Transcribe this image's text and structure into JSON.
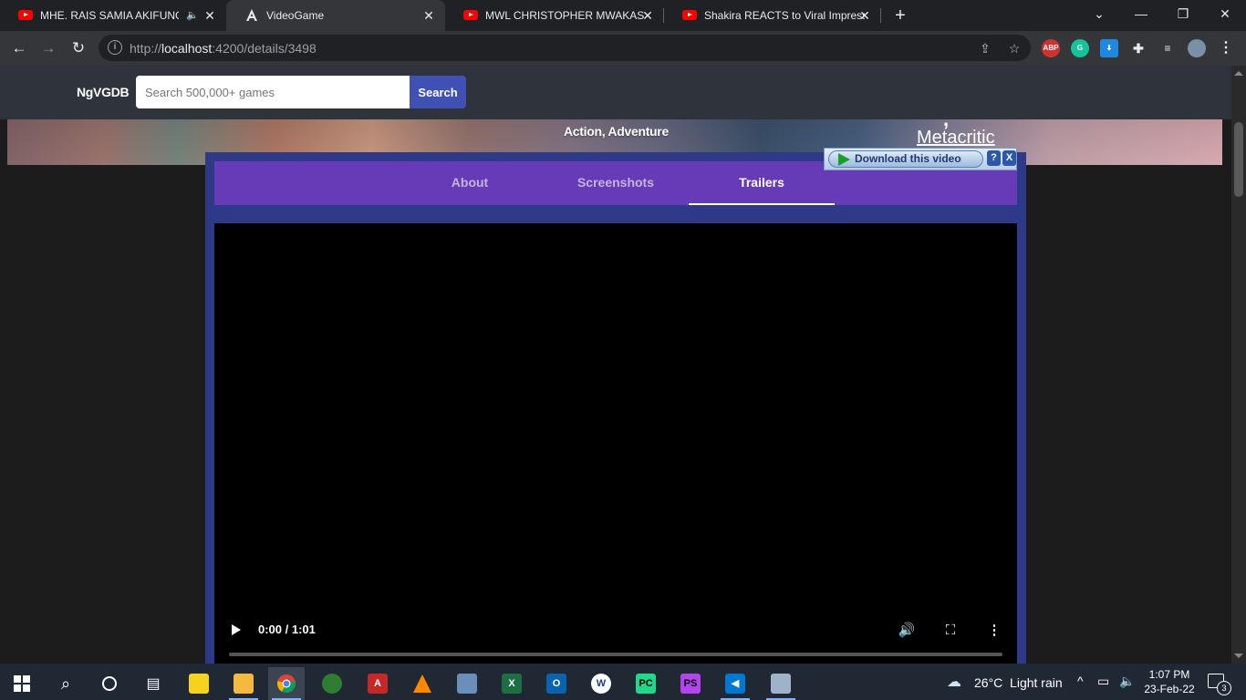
{
  "browser": {
    "tabs": [
      {
        "title": "MHE. RAIS SAMIA AKIFUNGUA",
        "icon": "youtube-icon",
        "audio": true
      },
      {
        "title": "VideoGame",
        "icon": "angular-icon",
        "active": true
      },
      {
        "title": "MWL CHRISTOPHER MWAKASEGE",
        "icon": "youtube-icon"
      },
      {
        "title": "Shakira REACTS to Viral Impressions",
        "icon": "youtube-icon"
      }
    ],
    "url_scheme": "http://",
    "url_host": "localhost",
    "url_path": ":4200/details/3498",
    "extensions": [
      "ABP"
    ]
  },
  "header": {
    "logo": "NgVGDB",
    "search_placeholder": "Search 500,000+ games",
    "search_button": "Search"
  },
  "hero": {
    "genres": "Action, Adventure",
    "rating_link": "Metacritic"
  },
  "details_tabs": [
    {
      "label": "About"
    },
    {
      "label": "Screenshots"
    },
    {
      "label": "Trailers",
      "active": true
    }
  ],
  "video": {
    "time": "0:00 / 1:01",
    "progress": 0
  },
  "download_bar": {
    "button": "Download this video",
    "help": "?",
    "close": "X"
  },
  "taskbar": {
    "weather": "26°C  Light rain",
    "time": "1:07 PM",
    "date": "23-Feb-22",
    "notifications": "3"
  }
}
